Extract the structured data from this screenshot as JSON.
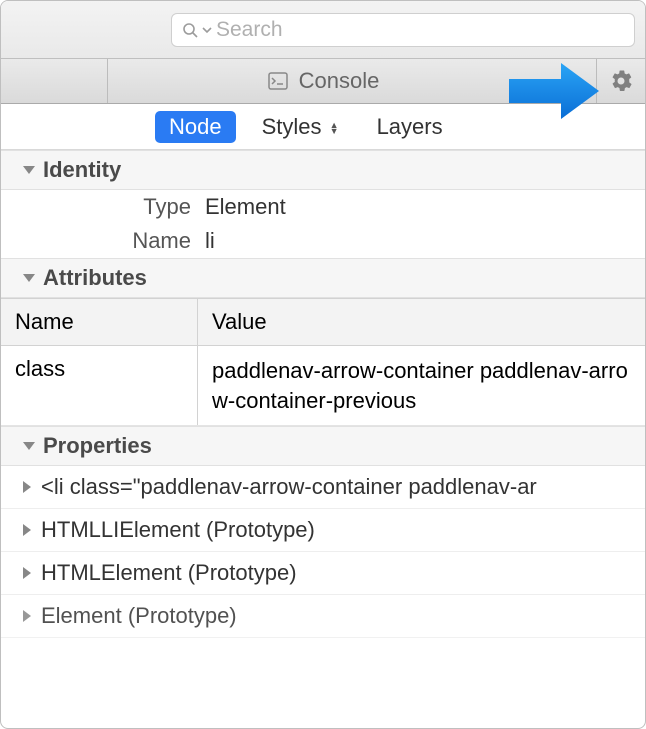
{
  "search": {
    "placeholder": "Search"
  },
  "toolbar": {
    "console_label": "Console"
  },
  "tabs": {
    "node": "Node",
    "styles": "Styles",
    "layers": "Layers"
  },
  "sections": {
    "identity": "Identity",
    "attributes": "Attributes",
    "properties": "Properties"
  },
  "identity": {
    "type_label": "Type",
    "type_value": "Element",
    "name_label": "Name",
    "name_value": "li"
  },
  "attributes_header": {
    "name": "Name",
    "value": "Value"
  },
  "attributes": [
    {
      "name": "class",
      "value": "paddlenav-arrow-container paddlenav-arrow-container-previous"
    }
  ],
  "properties": [
    "<li class=\"paddlenav-arrow-container paddlenav-ar",
    "HTMLLIElement (Prototype)",
    "HTMLElement (Prototype)",
    "Element (Prototype)"
  ]
}
